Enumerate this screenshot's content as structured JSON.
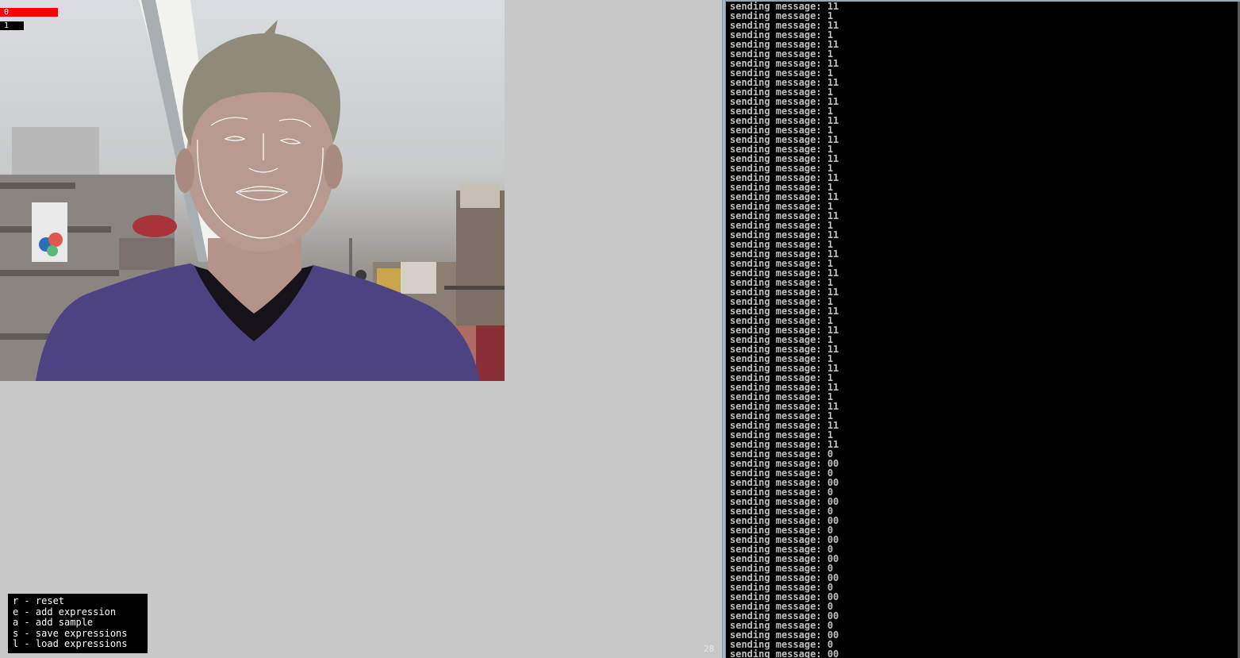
{
  "expression_bars": [
    {
      "label": "0",
      "color": "#ff0000"
    },
    {
      "label": "1",
      "color": "#000000"
    }
  ],
  "help": {
    "lines": [
      "r - reset",
      "e - add expression",
      "a - add sample",
      "s - save expressions",
      "l - load expressions"
    ]
  },
  "fps": "28",
  "face_overlay": {
    "color": "#ffffff"
  },
  "console": {
    "lines": [
      "sending message: 11",
      "sending message: 1",
      "sending message: 11",
      "sending message: 1",
      "sending message: 11",
      "sending message: 1",
      "sending message: 11",
      "sending message: 1",
      "sending message: 11",
      "sending message: 1",
      "sending message: 11",
      "sending message: 1",
      "sending message: 11",
      "sending message: 1",
      "sending message: 11",
      "sending message: 1",
      "sending message: 11",
      "sending message: 1",
      "sending message: 11",
      "sending message: 1",
      "sending message: 11",
      "sending message: 1",
      "sending message: 11",
      "sending message: 1",
      "sending message: 11",
      "sending message: 1",
      "sending message: 11",
      "sending message: 1",
      "sending message: 11",
      "sending message: 1",
      "sending message: 11",
      "sending message: 1",
      "sending message: 11",
      "sending message: 1",
      "sending message: 11",
      "sending message: 1",
      "sending message: 11",
      "sending message: 1",
      "sending message: 11",
      "sending message: 1",
      "sending message: 11",
      "sending message: 1",
      "sending message: 11",
      "sending message: 1",
      "sending message: 11",
      "sending message: 1",
      "sending message: 11",
      "sending message: 0",
      "sending message: 00",
      "sending message: 0",
      "sending message: 00",
      "sending message: 0",
      "sending message: 00",
      "sending message: 0",
      "sending message: 00",
      "sending message: 0",
      "sending message: 00",
      "sending message: 0",
      "sending message: 00",
      "sending message: 0",
      "sending message: 00",
      "sending message: 0",
      "sending message: 00",
      "sending message: 0",
      "sending message: 00",
      "sending message: 0",
      "sending message: 00",
      "sending message: 0",
      "sending message: 00",
      "sending message: 0"
    ]
  }
}
